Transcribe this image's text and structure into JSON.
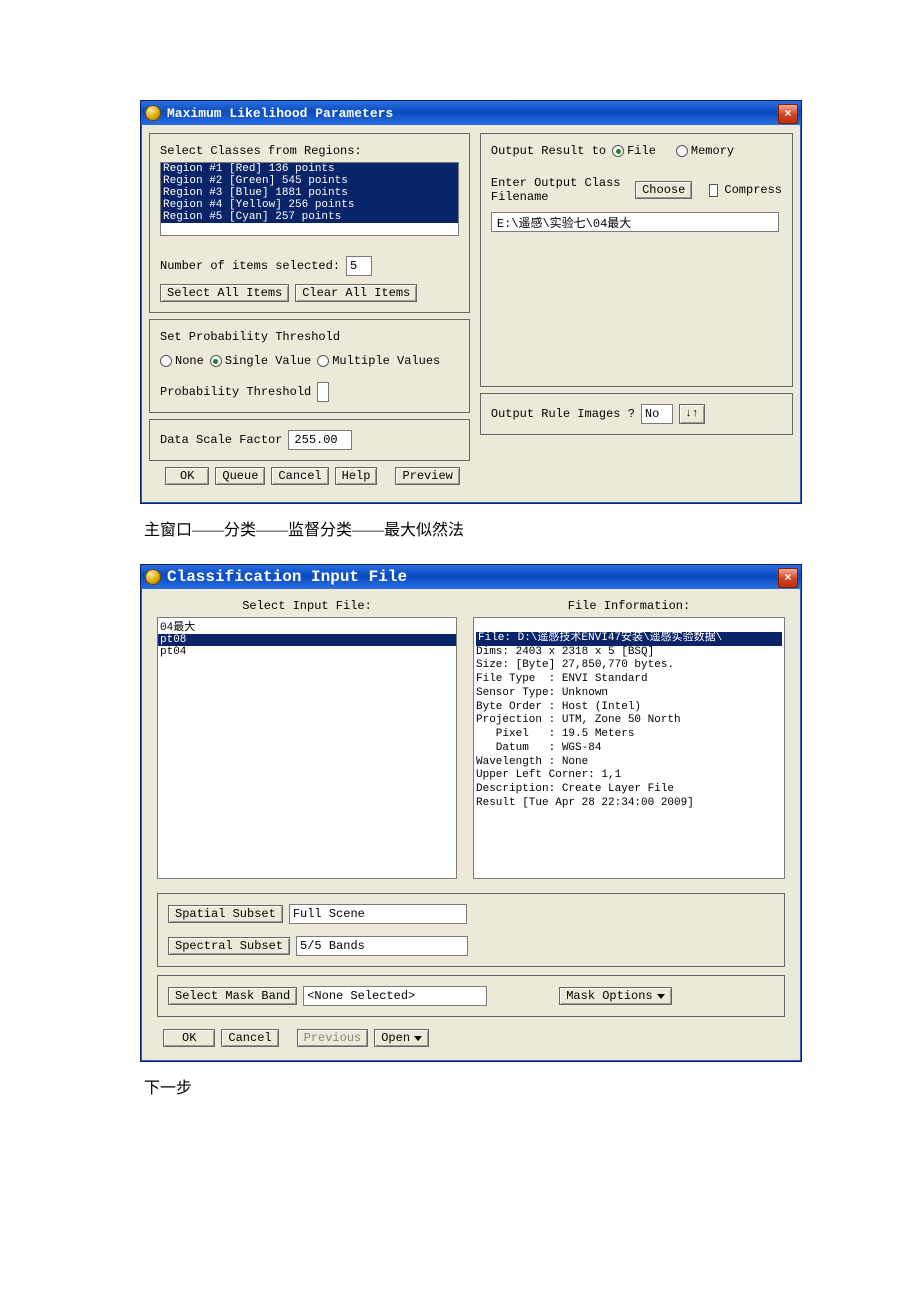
{
  "dialog1": {
    "title": "Maximum Likelihood Parameters",
    "left": {
      "select_classes_label": "Select Classes from Regions:",
      "regions": [
        "Region #1 [Red] 136 points",
        "Region #2 [Green] 545 points",
        "Region #3 [Blue] 1881 points",
        "Region #4 [Yellow] 256 points",
        "Region #5 [Cyan] 257 points"
      ],
      "num_items_label": "Number of items selected:",
      "num_items_value": "5",
      "select_all": "Select All Items",
      "clear_all": "Clear All Items",
      "set_prob_label": "Set Probability Threshold",
      "radio_none": "None",
      "radio_single": "Single Value",
      "radio_multiple": "Multiple Values",
      "prob_threshold_label": "Probability Threshold",
      "prob_threshold_value": "",
      "data_scale_label": "Data Scale Factor",
      "data_scale_value": "255.00"
    },
    "right": {
      "output_result_label": "Output Result to",
      "radio_file": "File",
      "radio_memory": "Memory",
      "enter_output_label": "Enter Output Class Filename",
      "choose": "Choose",
      "compress": "Compress",
      "output_path": "E:\\遥感\\实验七\\04最大",
      "rule_images_label": "Output Rule Images ?",
      "rule_images_value": "No"
    },
    "buttons": {
      "ok": "OK",
      "queue": "Queue",
      "cancel": "Cancel",
      "help": "Help",
      "preview": "Preview"
    }
  },
  "caption1": "主窗口——分类——监督分类——最大似然法",
  "dialog2": {
    "title": "Classification Input File",
    "left": {
      "select_input_label": "Select Input File:",
      "files": [
        "04最大",
        "pt08",
        "pt04"
      ]
    },
    "right": {
      "file_info_label": "File Information:",
      "lines": [
        "File: D:\\遥感技术ENVI47安装\\遥感实验数据\\",
        "Dims: 2403 x 2318 x 5 [BSQ]",
        "Size: [Byte] 27,850,770 bytes.",
        "File Type  : ENVI Standard",
        "Sensor Type: Unknown",
        "Byte Order : Host (Intel)",
        "Projection : UTM, Zone 50 North",
        "   Pixel   : 19.5 Meters",
        "   Datum   : WGS-84",
        "Wavelength : None",
        "Upper Left Corner: 1,1",
        "Description: Create Layer File",
        "Result [Tue Apr 28 22:34:00 2009]"
      ]
    },
    "spatial_subset_btn": "Spatial Subset",
    "spatial_subset_value": "Full Scene",
    "spectral_subset_btn": "Spectral Subset",
    "spectral_subset_value": "5/5 Bands",
    "select_mask_btn": "Select Mask Band",
    "select_mask_value": "<None Selected>",
    "mask_options": "Mask Options",
    "buttons": {
      "ok": "OK",
      "cancel": "Cancel",
      "previous": "Previous",
      "open": "Open"
    }
  },
  "caption2": "下一步"
}
